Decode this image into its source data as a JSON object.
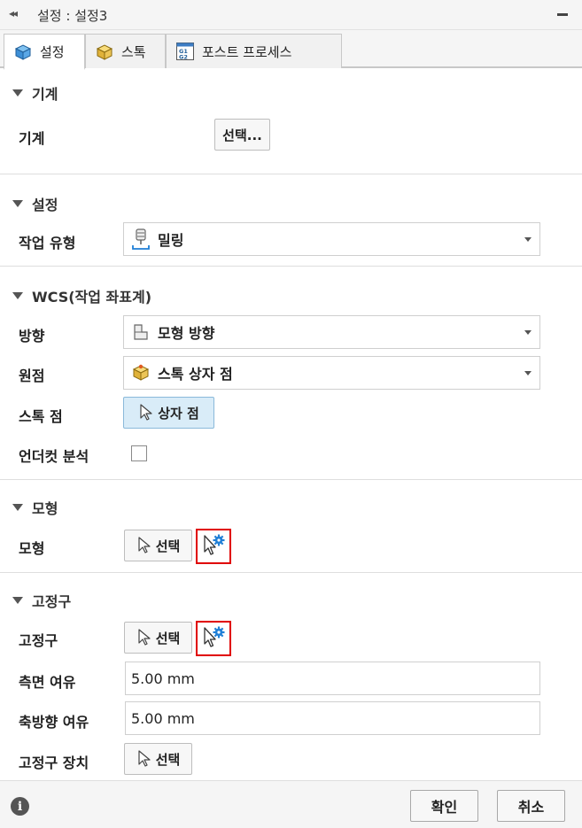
{
  "window": {
    "title": "설정 : 설정3"
  },
  "tabs": [
    {
      "label": "설정",
      "icon": "setup-cube-icon"
    },
    {
      "label": "스톡",
      "icon": "stock-box-icon"
    },
    {
      "label": "포스트 프로세스",
      "icon": "post-process-g1g2-icon"
    }
  ],
  "machine": {
    "header": "기계",
    "label": "기계",
    "button": "선택..."
  },
  "setup": {
    "header": "설정",
    "op_type_label": "작업 유형",
    "op_type_value": "밀링"
  },
  "wcs": {
    "header": "WCS(작업 좌표계)",
    "orientation_label": "방향",
    "orientation_value": "모형 방향",
    "origin_label": "원점",
    "origin_value": "스톡 상자 점",
    "stock_point_label": "스톡 점",
    "stock_point_button": "상자 점",
    "undercut_label": "언더컷 분석",
    "undercut_checked": false
  },
  "model": {
    "header": "모형",
    "label": "모형",
    "button": "선택"
  },
  "fixture": {
    "header": "고정구",
    "label": "고정구",
    "button": "선택",
    "side_margin_label": "측면 여유",
    "side_margin_value": "5.00 mm",
    "axial_margin_label": "축방향 여유",
    "axial_margin_value": "5.00 mm",
    "device_label": "고정구 장치",
    "device_button": "선택"
  },
  "footer": {
    "ok": "확인",
    "cancel": "취소"
  },
  "colors": {
    "highlight_border": "#e00000",
    "selected_button_bg": "#d9ecf8",
    "gear_blue": "#1f7fd6"
  }
}
